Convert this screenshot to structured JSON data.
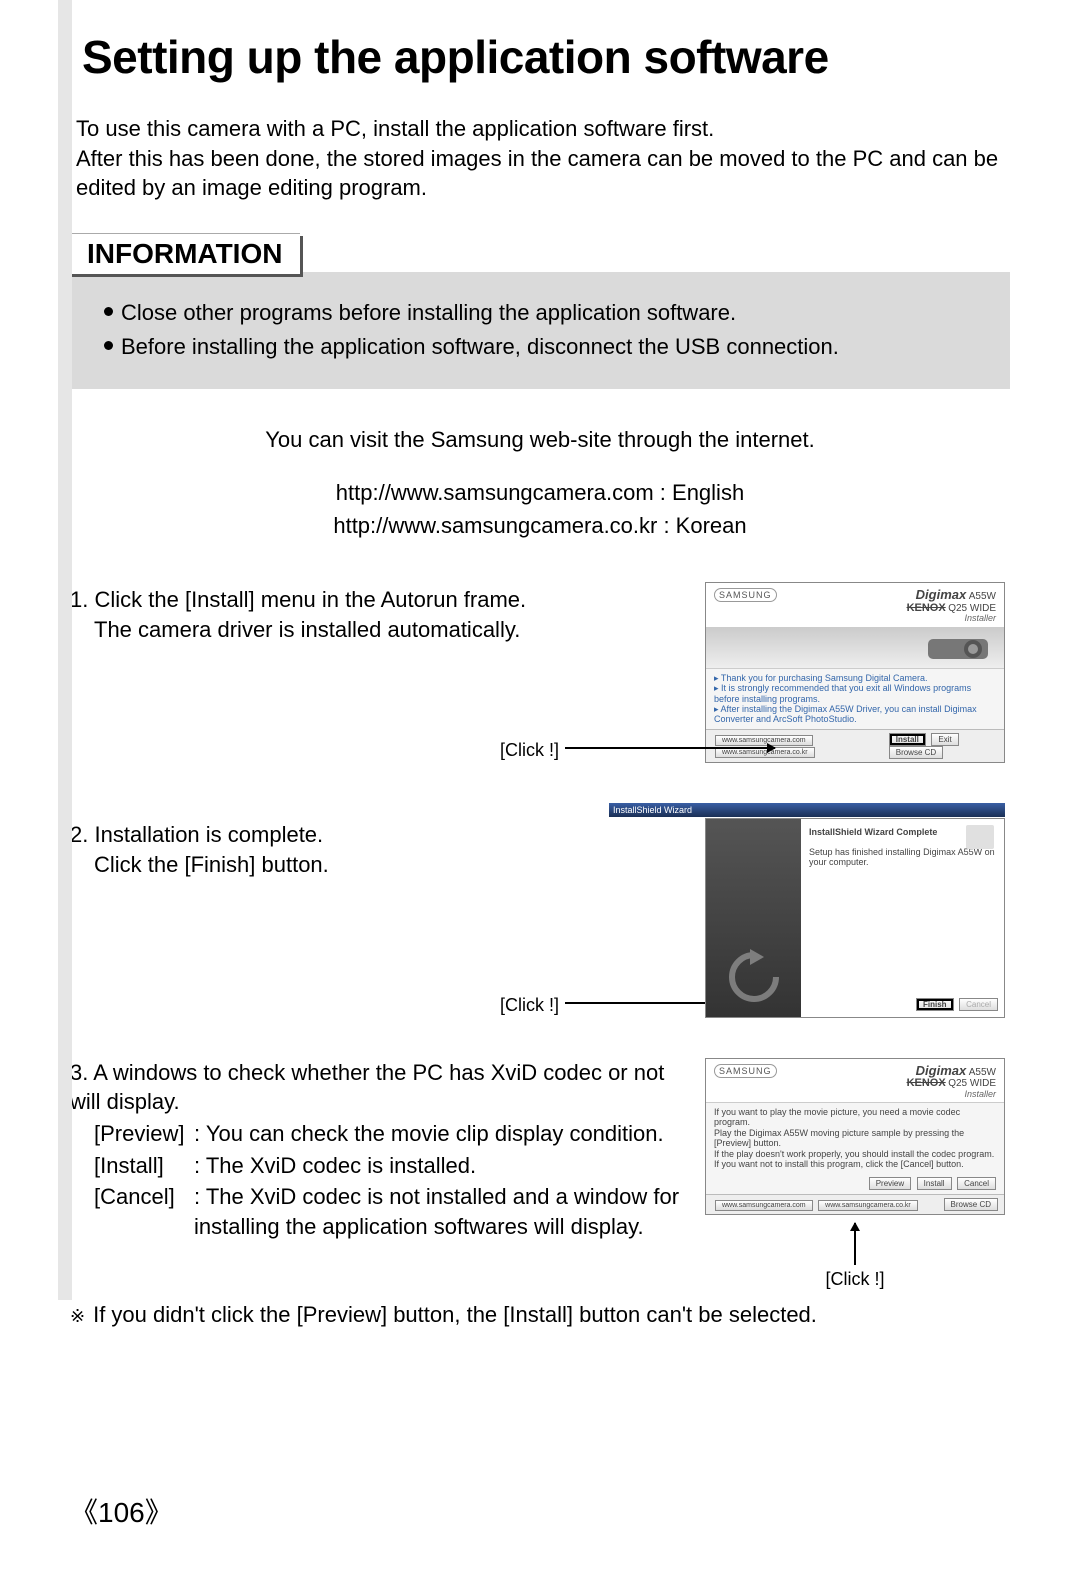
{
  "title": "Setting up the application software",
  "intro": "To use this camera with a PC, install the application software first.\nAfter this has been done, the stored images in the camera can be moved to the PC and can be edited by an image editing program.",
  "info": {
    "header": "INFORMATION",
    "bullets": [
      "Close other programs before installing the application software.",
      "Before installing the application software, disconnect the USB connection."
    ]
  },
  "visit_line": "You can visit the Samsung web-site through the internet.",
  "urls": {
    "en": "http://www.samsungcamera.com : English",
    "kr": "http://www.samsungcamera.co.kr : Korean"
  },
  "steps": {
    "s1": {
      "num": "1.",
      "line1": "Click the [Install] menu in the Autorun frame.",
      "line2": "The camera driver is installed automatically.",
      "click": "[Click !]"
    },
    "s2": {
      "num": "2.",
      "line1": "Installation is complete.",
      "line2": "Click the [Finish] button.",
      "click": "[Click !]"
    },
    "s3": {
      "num": "3.",
      "line1": "A windows to check whether the PC has XviD codec or not will display.",
      "defs": [
        {
          "label": "[Preview]",
          "desc": ": You can check the movie clip display condition."
        },
        {
          "label": "[Install]",
          "desc": ": The XviD codec is installed."
        },
        {
          "label": "[Cancel]",
          "desc": ": The XviD codec is not installed and a window for installing the application softwares will display."
        }
      ],
      "click": "[Click !]"
    }
  },
  "note_symbol": "※",
  "note": "If you didn't click the [Preview] button, the [Install] button can't be selected.",
  "shots": {
    "brand_logo": "SAMSUNG",
    "brand_digimax": "Digimax",
    "brand_model_a": "A55W",
    "brand_kenox": "KENOX",
    "brand_model_b": "Q25 WIDE",
    "installer": "Installer",
    "s1": {
      "body1": "Thank you for purchasing Samsung Digital Camera.",
      "body2": "It is strongly recommended that you exit all Windows programs before installing programs.",
      "body3": "After installing the Digimax A55W Driver, you can install Digimax Converter and ArcSoft PhotoStudio.",
      "btn_install": "Install",
      "btn_exit": "Exit",
      "foot1": "www.samsungcamera.com",
      "foot2": "www.samsungcamera.co.kr",
      "foot_btn": "Browse CD"
    },
    "s2": {
      "titlebar": "InstallShield Wizard",
      "h": "InstallShield Wizard Complete",
      "body": "Setup has finished installing Digimax A55W on your computer.",
      "btn_finish": "Finish",
      "btn_cancel": "Cancel"
    },
    "s3": {
      "body1": "If you want to play the movie picture, you need a movie codec program.",
      "body2": "Play the Digimax A55W moving picture sample by pressing the [Preview] button.",
      "body3": "If the play doesn't work properly, you should install the codec program.",
      "body4": "If you want not to install this program, click the [Cancel] button.",
      "btn_preview": "Preview",
      "btn_install": "Install",
      "btn_cancel": "Cancel",
      "foot1": "www.samsungcamera.com",
      "foot2": "www.samsungcamera.co.kr",
      "foot_btn": "Browse CD"
    }
  },
  "page_number": "106"
}
